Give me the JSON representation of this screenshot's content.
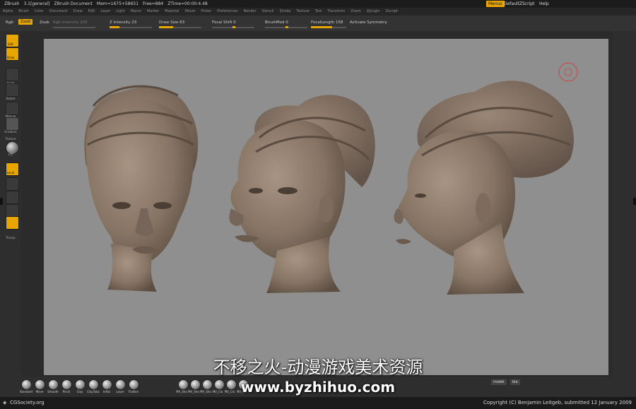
{
  "titlebar": {
    "app": "ZBrush",
    "version": "3.1[general]",
    "document": "ZBrush Document",
    "mem": "Mem=1675+58651",
    "free": "Free=884",
    "ztime": "ZTime=00:00:4.48",
    "menus_button": "Menus",
    "script_button": "DefaultZScript",
    "help_button": "Help"
  },
  "menubar": {
    "items": [
      "Alpha",
      "Brush",
      "Color",
      "Document",
      "Draw",
      "Edit",
      "Layer",
      "Light",
      "Macro",
      "Marker",
      "Material",
      "Movie",
      "Picker",
      "Preferences",
      "Render",
      "Stencil",
      "Stroke",
      "Texture",
      "Tool",
      "Transform",
      "Zoom",
      "Zplugin",
      "Zscript"
    ]
  },
  "toolbar": {
    "rgb_label": "Rgb",
    "zadd_label": "Zadd",
    "zsub_label": "Zsub",
    "rgb_intensity": "Rgb Intensity 100",
    "z_intensity": "Z Intensity 23",
    "draw_size": "Draw Size 63",
    "focal_shift": "Focal Shift 0",
    "brushmod": "BrushMod 0",
    "focal_length": "FocalLength 158",
    "activate_symmetry": "Activate Symmetry"
  },
  "left_shelf": {
    "edit": "Edit",
    "draw": "Draw",
    "scale": "Scale",
    "rotate": "Rotate",
    "material": "Matcap",
    "gradient": "Gradient",
    "texture": "Texture",
    "xyz": "xYZ",
    "local": "Local",
    "transp": "Transp"
  },
  "bottom_shelf": {
    "brushes": [
      "Standard",
      "Move",
      "Smooth",
      "Pinch",
      "Clay",
      "ClayTubs",
      "Inflat",
      "Layer",
      "Flatten"
    ],
    "materials": [
      "MV_Sha",
      "MV_Sha",
      "MV_Sha",
      "MV_Cla",
      "MV_Cla",
      "MV_Fla"
    ],
    "mode_label": "model",
    "mode_value": "bla"
  },
  "footer": {
    "site": "CGSociety.org",
    "copyright": "Copyright (C) Benjamin Leitgeb, submitted 12 January 2009"
  },
  "watermark": {
    "line1": "不移之火-动漫游戏美术资源",
    "line2": "www.byzhihuo.com"
  },
  "colors": {
    "accent": "#e8a500",
    "canvas": "#8f8f8f",
    "sculpt": "#8b7a6c"
  }
}
